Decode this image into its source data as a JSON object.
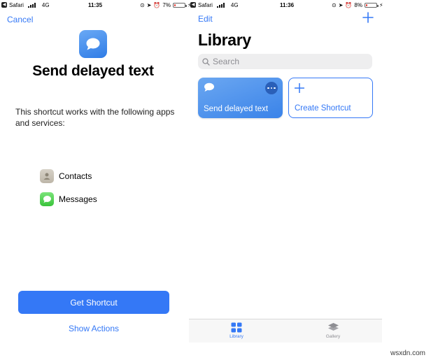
{
  "left_screen": {
    "status_bar": {
      "carrier": "Safari",
      "network": "4G",
      "time": "11:35",
      "battery": "7%",
      "battery_level": 0.07
    },
    "cancel_label": "Cancel",
    "title": "Send delayed text",
    "description": "This shortcut works with the following apps and services:",
    "services": [
      {
        "name": "Contacts",
        "icon": "contacts-icon"
      },
      {
        "name": "Messages",
        "icon": "messages-icon"
      }
    ],
    "get_shortcut_label": "Get Shortcut",
    "show_actions_label": "Show Actions"
  },
  "right_screen": {
    "status_bar": {
      "carrier": "Safari",
      "network": "4G",
      "time": "11:36",
      "battery": "8%",
      "battery_level": 0.08
    },
    "edit_label": "Edit",
    "title": "Library",
    "search_placeholder": "Search",
    "cards": {
      "shortcut_label": "Send delayed text",
      "create_label": "Create Shortcut"
    },
    "tabs": {
      "library": "Library",
      "gallery": "Gallery"
    }
  },
  "watermark": "wsxdn.com",
  "colors": {
    "accent": "#3478f6",
    "battery_low": "#e0342c"
  }
}
